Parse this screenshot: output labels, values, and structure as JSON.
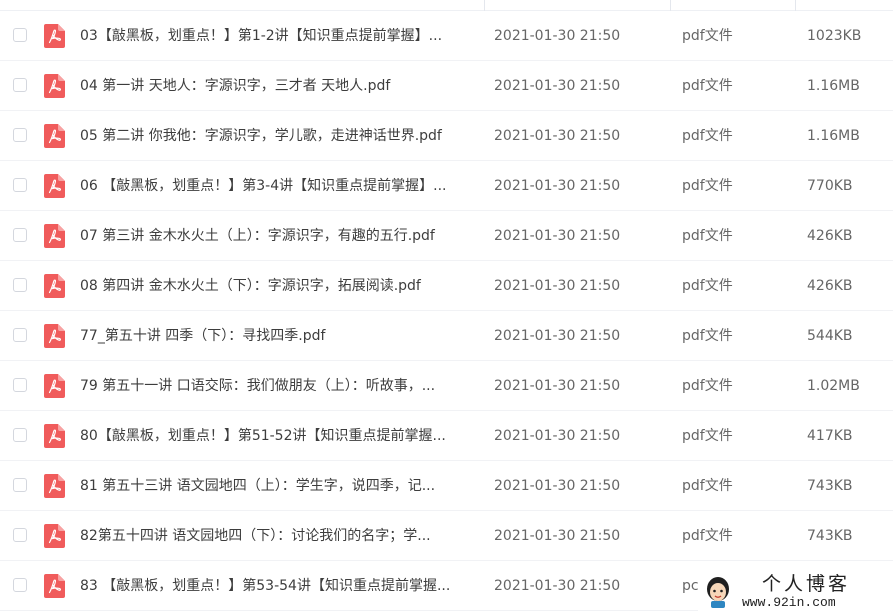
{
  "files": [
    {
      "name": "03【敲黑板，划重点！】第1-2讲【知识重点提前掌握】...",
      "date": "2021-01-30 21:50",
      "type": "pdf文件",
      "size": "1023KB"
    },
    {
      "name": "04 第一讲 天地人：字源识字，三才者 天地人.pdf",
      "date": "2021-01-30 21:50",
      "type": "pdf文件",
      "size": "1.16MB"
    },
    {
      "name": "05 第二讲 你我他：字源识字，学儿歌，走进神话世界.pdf",
      "date": "2021-01-30 21:50",
      "type": "pdf文件",
      "size": "1.16MB"
    },
    {
      "name": "06 【敲黑板，划重点！】第3-4讲【知识重点提前掌握】...",
      "date": "2021-01-30 21:50",
      "type": "pdf文件",
      "size": "770KB"
    },
    {
      "name": "07 第三讲 金木水火土（上）：字源识字，有趣的五行.pdf",
      "date": "2021-01-30 21:50",
      "type": "pdf文件",
      "size": "426KB"
    },
    {
      "name": "08 第四讲 金木水火土（下）：字源识字，拓展阅读.pdf",
      "date": "2021-01-30 21:50",
      "type": "pdf文件",
      "size": "426KB"
    },
    {
      "name": "77_第五十讲 四季（下）：寻找四季.pdf",
      "date": "2021-01-30 21:50",
      "type": "pdf文件",
      "size": "544KB"
    },
    {
      "name": "79 第五十一讲 口语交际：我们做朋友（上）：听故事，...",
      "date": "2021-01-30 21:50",
      "type": "pdf文件",
      "size": "1.02MB"
    },
    {
      "name": "80【敲黑板，划重点！】第51-52讲【知识重点提前掌握...",
      "date": "2021-01-30 21:50",
      "type": "pdf文件",
      "size": "417KB"
    },
    {
      "name": "81 第五十三讲 语文园地四（上）：学生字，说四季，记...",
      "date": "2021-01-30 21:50",
      "type": "pdf文件",
      "size": "743KB"
    },
    {
      "name": "82第五十四讲 语文园地四（下）：讨论我们的名字；学...",
      "date": "2021-01-30 21:50",
      "type": "pdf文件",
      "size": "743KB"
    },
    {
      "name": "83 【敲黑板，划重点！】第53-54讲【知识重点提前掌握...",
      "date": "2021-01-30 21:50",
      "type": "pc",
      "size": ""
    }
  ],
  "watermark": {
    "title": "个人博客",
    "url": "www.92in.com"
  },
  "colors": {
    "pdf_icon": "#f05b5b",
    "row_divider": "#f1f2f5",
    "checkbox_border": "#d4d7de"
  }
}
